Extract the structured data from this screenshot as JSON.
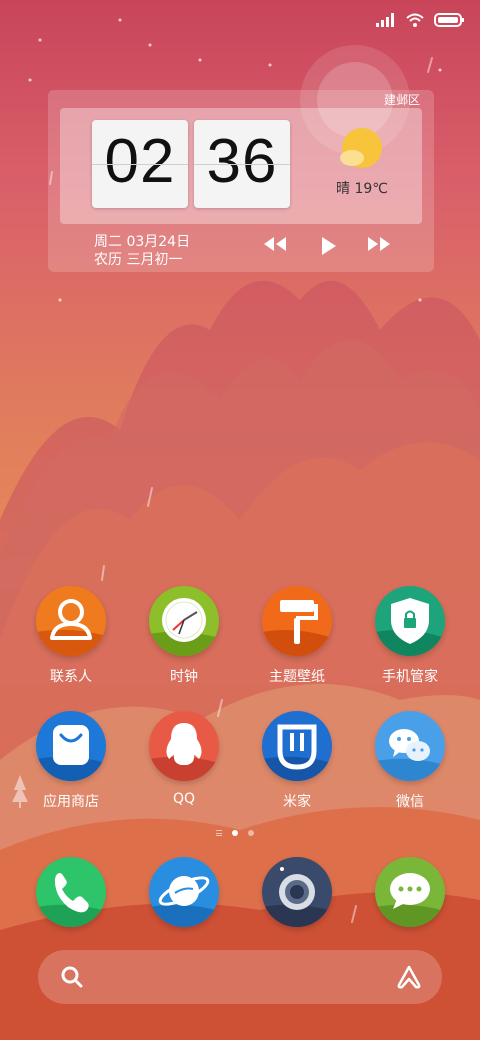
{
  "status_bar": {
    "icons": [
      "signal-icon",
      "wifi-icon",
      "battery-icon"
    ]
  },
  "widget": {
    "district": "建邺区",
    "hour": "02",
    "minute": "36",
    "weather": "晴  19℃",
    "weather_icon": "sunny-icon",
    "date": "周二 03月24日",
    "lunar": "农历 三月初一",
    "media_controls": [
      "previous-icon",
      "play-icon",
      "next-icon"
    ]
  },
  "apps": [
    {
      "label": "联系人",
      "icon": "contacts-icon"
    },
    {
      "label": "时钟",
      "icon": "clock-icon"
    },
    {
      "label": "主题壁纸",
      "icon": "paint-roller-icon"
    },
    {
      "label": "手机管家",
      "icon": "shield-icon"
    },
    {
      "label": "应用商店",
      "icon": "app-store-icon"
    },
    {
      "label": "QQ",
      "icon": "qq-penguin-icon"
    },
    {
      "label": "米家",
      "icon": "mijia-icon"
    },
    {
      "label": "微信",
      "icon": "wechat-icon"
    }
  ],
  "dock": [
    {
      "icon": "phone-icon"
    },
    {
      "icon": "browser-planet-icon"
    },
    {
      "icon": "camera-icon"
    },
    {
      "icon": "messages-icon"
    }
  ],
  "page_indicator": {
    "pages": 2,
    "active": 1
  },
  "search": {
    "icon": "search-icon",
    "assistant_icon": "assistant-icon"
  },
  "colors": {
    "contacts": "#f07a1e",
    "clock": "#8cbf2a",
    "theme": "#f06a1a",
    "security": "#1ea47a",
    "app_store": "#1e78d8",
    "qq": "#e85a46",
    "mijia": "#1e6fd0",
    "wechat": "#4aa0e8",
    "phone": "#2ec46a",
    "browser": "#2a8ee0",
    "camera": "#3a4a6a",
    "messages": "#7ab638"
  }
}
